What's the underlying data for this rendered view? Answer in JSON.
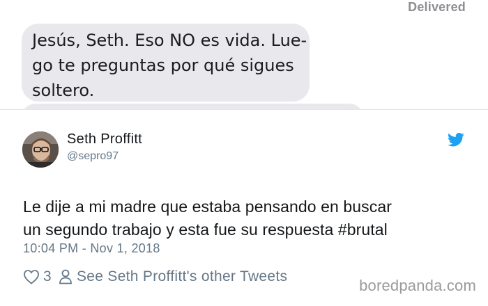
{
  "message": {
    "status": "Delivered",
    "bubble_lines": [
      "Jesús, Seth. Eso NO es vida. Lue-",
      "go te preguntas por qué sigues",
      "soltero."
    ]
  },
  "tweet": {
    "author_name": "Seth Proffitt",
    "author_handle": "@sepro97",
    "text_lines": [
      "Le dije a mi madre que estaba pensando en buscar",
      "un segundo trabajo y esta fue su respuesta #brutal"
    ],
    "timestamp": "10:04 PM - Nov 1, 2018",
    "likes": "3",
    "profile_link": "See Seth Proffitt's other Tweets",
    "icons": {
      "brand": "twitter-bird-icon",
      "like": "heart-icon",
      "profile": "person-icon"
    },
    "colors": {
      "brand": "#1da1f2",
      "secondary_text": "#657786",
      "primary_text": "#14171a",
      "bubble": "#e8e8ed"
    }
  },
  "watermark": "boredpanda.com"
}
